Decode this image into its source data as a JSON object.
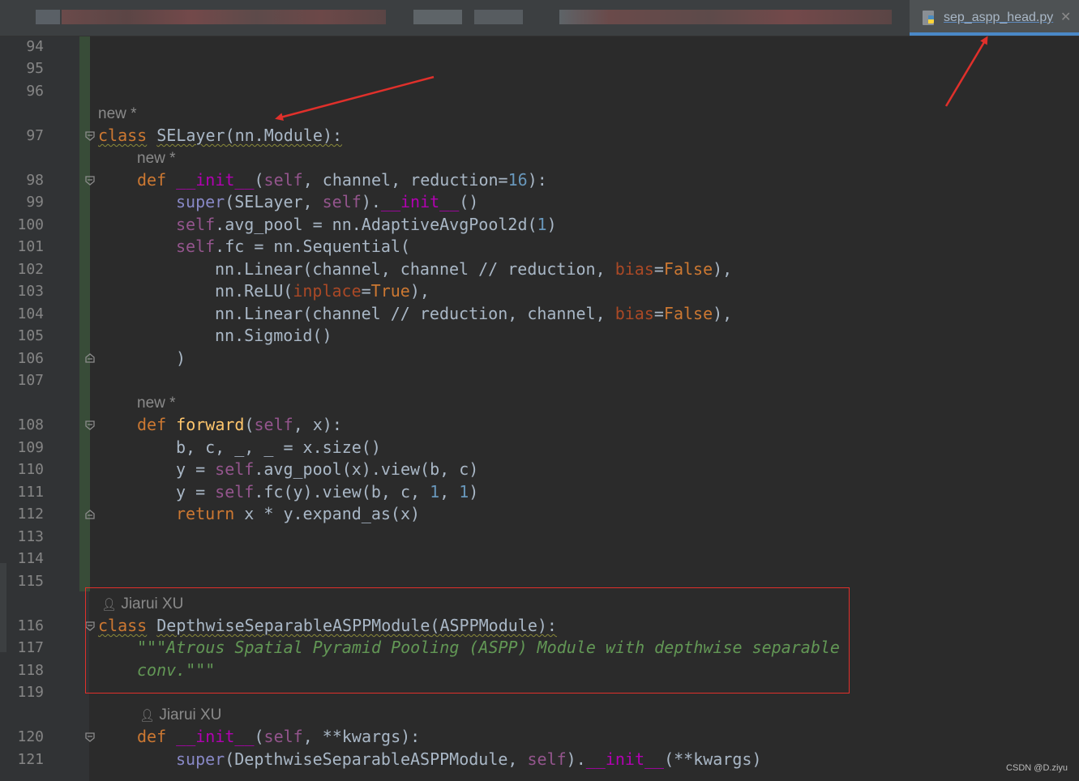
{
  "tab": {
    "active_label": "sep_aspp_head.py",
    "close_symbol": "✕",
    "icon": "python-file-icon"
  },
  "gutter": {
    "line_numbers": [
      "94",
      "95",
      "96",
      "97",
      "98",
      "99",
      "100",
      "101",
      "102",
      "103",
      "104",
      "105",
      "106",
      "107",
      "108",
      "109",
      "110",
      "111",
      "112",
      "113",
      "114",
      "115",
      "116",
      "117",
      "118",
      "119",
      "120",
      "121"
    ]
  },
  "hints": {
    "new_class": "new *",
    "new_init": "new *",
    "new_forward": "new *",
    "author_class": "Jiarui XU",
    "author_init": "Jiarui XU"
  },
  "code": {
    "l97": [
      "class",
      " ",
      "SELayer",
      "(nn.Module):"
    ],
    "l98": [
      "def",
      " ",
      "__init__",
      "(",
      "self",
      ", channel, reduction=",
      "16",
      "):"
    ],
    "l99": [
      "super",
      "(SELayer, ",
      "self",
      ").",
      "__init__",
      "()"
    ],
    "l100": [
      "self",
      ".avg_pool = nn.AdaptiveAvgPool2d(",
      "1",
      ")"
    ],
    "l101": [
      "self",
      ".fc = nn.Sequential("
    ],
    "l102": [
      "nn.Linear(channel, channel // reduction, ",
      "bias",
      "=",
      "False",
      "),"
    ],
    "l103": [
      "nn.ReLU(",
      "inplace",
      "=",
      "True",
      "),"
    ],
    "l104": [
      "nn.Linear(channel // reduction, channel, ",
      "bias",
      "=",
      "False",
      "),"
    ],
    "l105": [
      "nn.Sigmoid()"
    ],
    "l106": [
      ")"
    ],
    "l108": [
      "def",
      " ",
      "forward",
      "(",
      "self",
      ", x):"
    ],
    "l109": [
      "b, c, _, _ = x.size()"
    ],
    "l110": [
      "y = ",
      "self",
      ".avg_pool(x).view(b, c)"
    ],
    "l111": [
      "y = ",
      "self",
      ".fc(y).view(b, c, ",
      "1",
      ", ",
      "1",
      ")"
    ],
    "l112": [
      "return",
      " x * y.expand_as(x)"
    ],
    "l116": [
      "class",
      " ",
      "DepthwiseSeparableASPPModule",
      "(ASPPModule):"
    ],
    "l117": [
      "\"\"\"Atrous Spatial Pyramid Pooling (ASPP) Module with depthwise separable"
    ],
    "l118": [
      "conv.\"\"\""
    ],
    "l120": [
      "def",
      " ",
      "__init__",
      "(",
      "self",
      ", **kwargs):"
    ],
    "l121": [
      "super",
      "(DepthwiseSeparableASPPModule, ",
      "self",
      ").",
      "__init__",
      "(**kwargs)"
    ]
  },
  "watermark": "CSDN @D.ziyu",
  "colors": {
    "keyword": "#cc7832",
    "self": "#94558d",
    "number": "#6897bb",
    "function": "#ffc66d",
    "docstring": "#629755",
    "highlight_box": "#e0302b",
    "annotation_arrow": "#e0302b"
  }
}
